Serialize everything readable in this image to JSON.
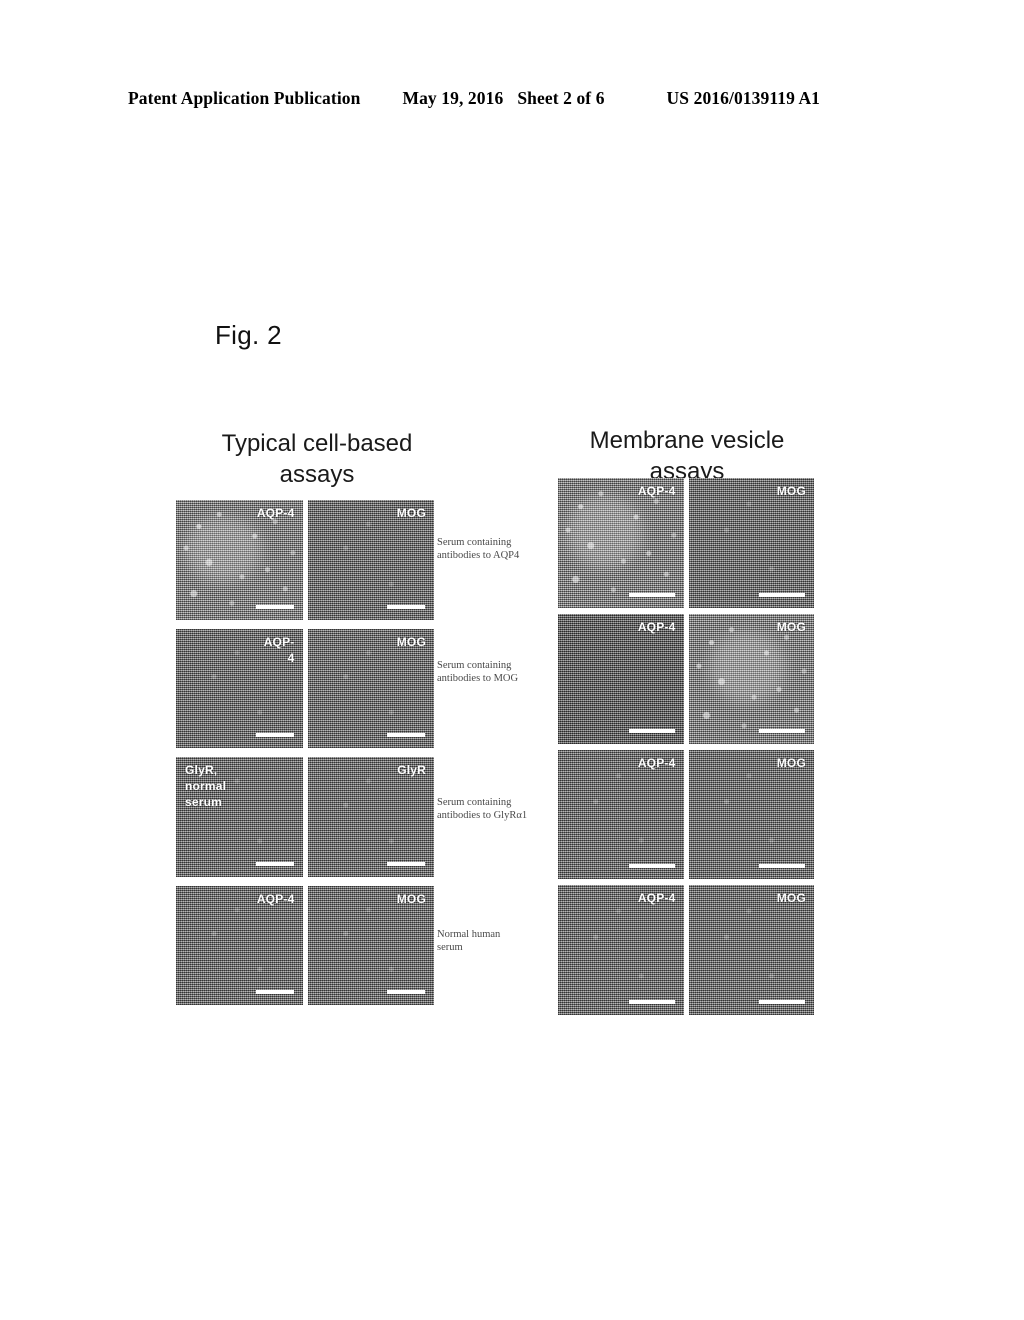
{
  "header": {
    "publication": "Patent Application Publication",
    "date": "May 19, 2016",
    "sheet": "Sheet 2 of 6",
    "patent_number": "US 2016/0139119 A1"
  },
  "figure": {
    "label": "Fig. 2"
  },
  "columns": {
    "left": {
      "line1": "Typical cell-based",
      "line2": "assays"
    },
    "right": {
      "line1": "Membrane vesicle",
      "line2": "assays"
    }
  },
  "row_labels": [
    {
      "line1": "Serum containing",
      "line2": "antibodies to AQP4"
    },
    {
      "line1": "Serum containing",
      "line2": "antibodies to MOG"
    },
    {
      "line1": "Serum containing",
      "line2": "antibodies to GlyRα1"
    },
    {
      "line1": "Normal human",
      "line2": "serum"
    }
  ],
  "left_grid": {
    "panels": [
      {
        "lines": [
          "AQP-4"
        ],
        "tone": "bright",
        "label_pos": "pos-tr"
      },
      {
        "lines": [
          "MOG"
        ],
        "tone": "mid",
        "label_pos": "pos-tr"
      },
      {
        "lines": [
          "AQP-",
          "4"
        ],
        "tone": "mid",
        "label_pos": "pos-tr"
      },
      {
        "lines": [
          "MOG"
        ],
        "tone": "mid",
        "label_pos": "pos-tr"
      },
      {
        "lines": [
          "GlyR,",
          "normal",
          "serum"
        ],
        "tone": "mid",
        "label_pos": "pos-tl"
      },
      {
        "lines": [
          "GlyR"
        ],
        "tone": "mid",
        "label_pos": "pos-tr"
      },
      {
        "lines": [
          "AQP-4"
        ],
        "tone": "mid",
        "label_pos": "pos-tr"
      },
      {
        "lines": [
          "MOG"
        ],
        "tone": "mid",
        "label_pos": "pos-tr"
      }
    ]
  },
  "right_grid": {
    "panels": [
      {
        "lines": [
          "AQP-4"
        ],
        "tone": "bright",
        "label_pos": "pos-tr"
      },
      {
        "lines": [
          "MOG"
        ],
        "tone": "mid",
        "label_pos": "pos-tr"
      },
      {
        "lines": [
          "AQP-4"
        ],
        "tone": "dark",
        "label_pos": "pos-tr"
      },
      {
        "lines": [
          "MOG"
        ],
        "tone": "bright",
        "label_pos": "pos-tr"
      },
      {
        "lines": [
          "AQP-4"
        ],
        "tone": "mid",
        "label_pos": "pos-tr"
      },
      {
        "lines": [
          "MOG"
        ],
        "tone": "mid",
        "label_pos": "pos-tr"
      },
      {
        "lines": [
          "AQP-4"
        ],
        "tone": "mid",
        "label_pos": "pos-tr"
      },
      {
        "lines": [
          "MOG"
        ],
        "tone": "mid",
        "label_pos": "pos-tr"
      }
    ]
  },
  "colors": {
    "page_background": "#ffffff",
    "text": "#000000",
    "row_label_text": "#4a4a4a",
    "panel_label_text": "#ffffff",
    "scale_bar": "#ffffff"
  }
}
